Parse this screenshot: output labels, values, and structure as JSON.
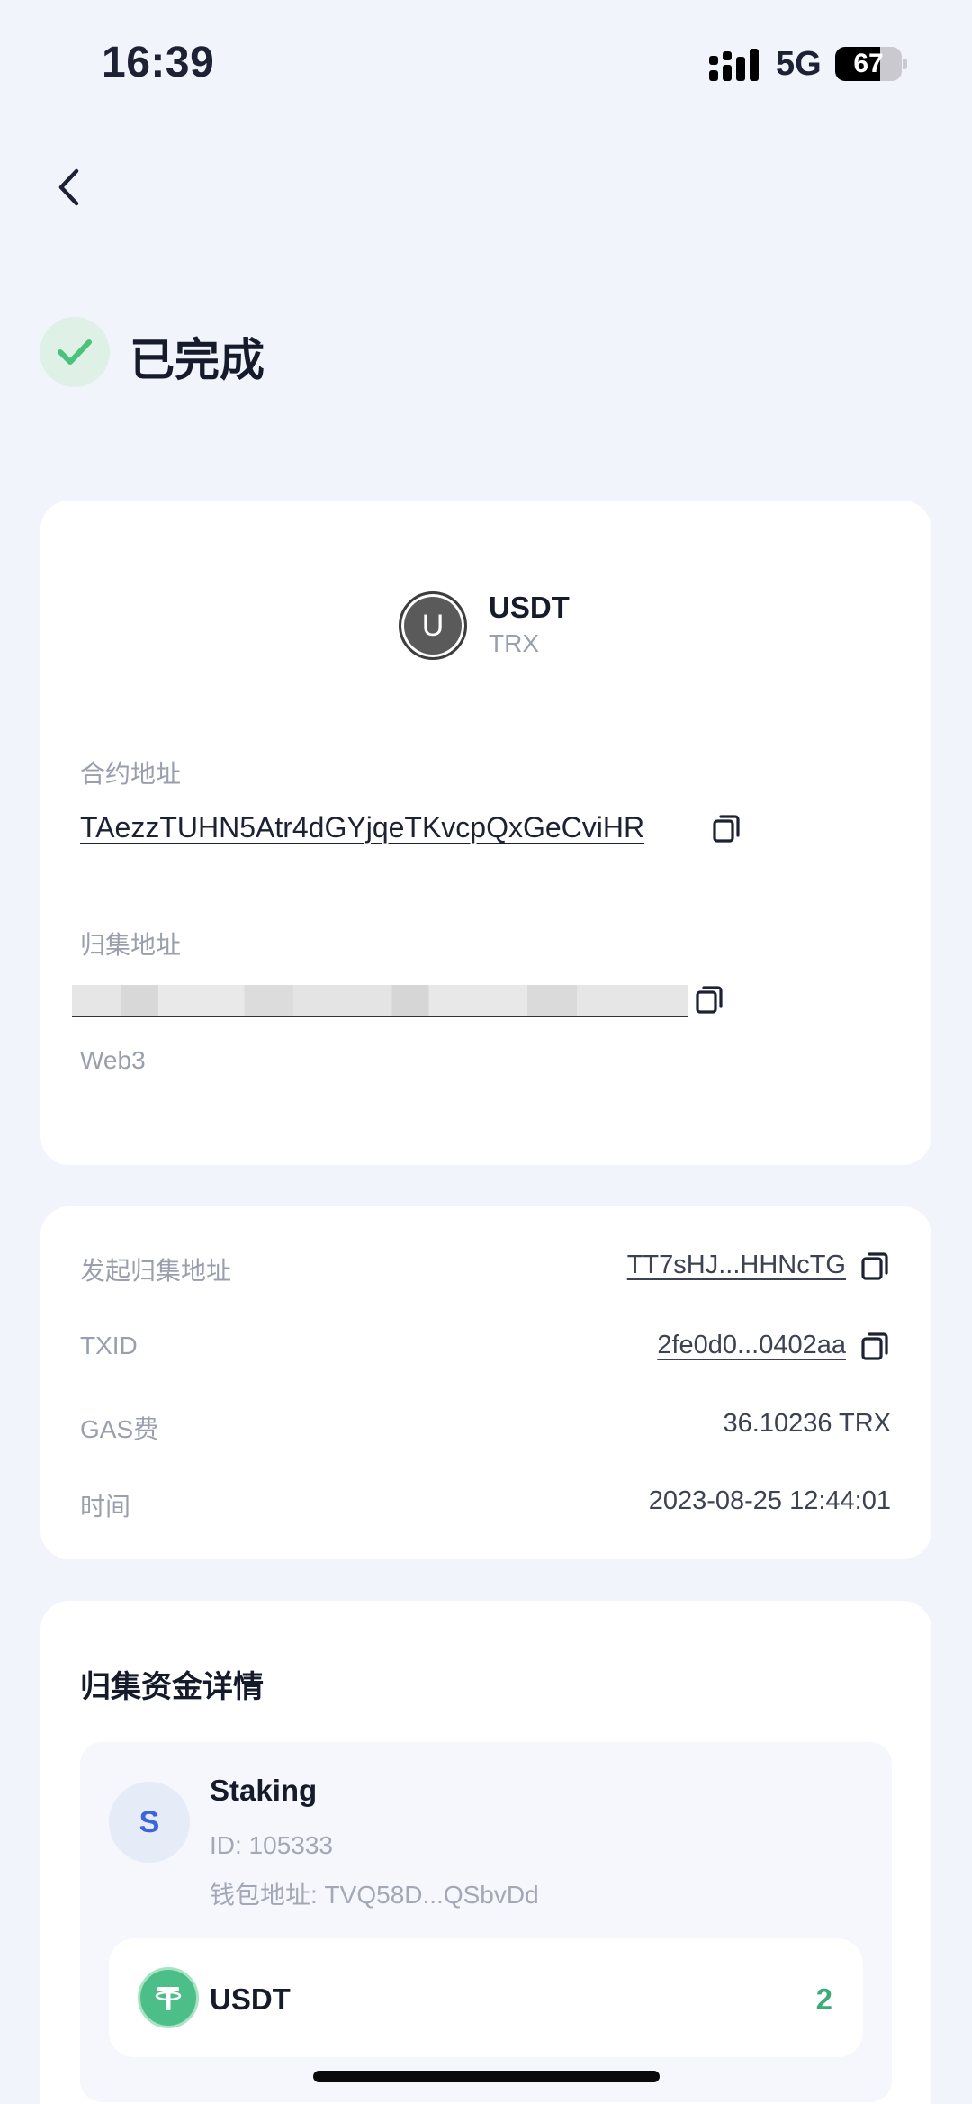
{
  "status_bar": {
    "time": "16:39",
    "network": "5G",
    "battery": "67",
    "battery_level": 0.67
  },
  "header": {
    "back_icon": "chevron-left-icon",
    "status_icon": "check-icon",
    "status_title": "已完成",
    "status_color": "#4cc17c"
  },
  "token": {
    "avatar_letter": "U",
    "name": "USDT",
    "chain": "TRX"
  },
  "contract": {
    "label": "合约地址",
    "address": "TAezzTUHN5Atr4dGYjqeTKvcpQxGeCviHR"
  },
  "collection": {
    "label": "归集地址",
    "address_note": "Web3"
  },
  "details": {
    "initiator_label": "发起归集地址",
    "initiator_value": "TT7sHJ...HHNcTG",
    "txid_label": "TXID",
    "txid_value": "2fe0d0...0402aa",
    "gas_label": "GAS费",
    "gas_value": "36.10236 TRX",
    "time_label": "时间",
    "time_value": "2023-08-25 12:44:01"
  },
  "funds": {
    "title": "归集资金详情",
    "account": {
      "avatar_letter": "S",
      "name": "Staking",
      "id": "ID: 105333",
      "wallet": "钱包地址: TVQ58D...QSbvDd"
    },
    "asset": {
      "icon": "tether-icon",
      "name": "USDT",
      "amount": "2"
    }
  }
}
